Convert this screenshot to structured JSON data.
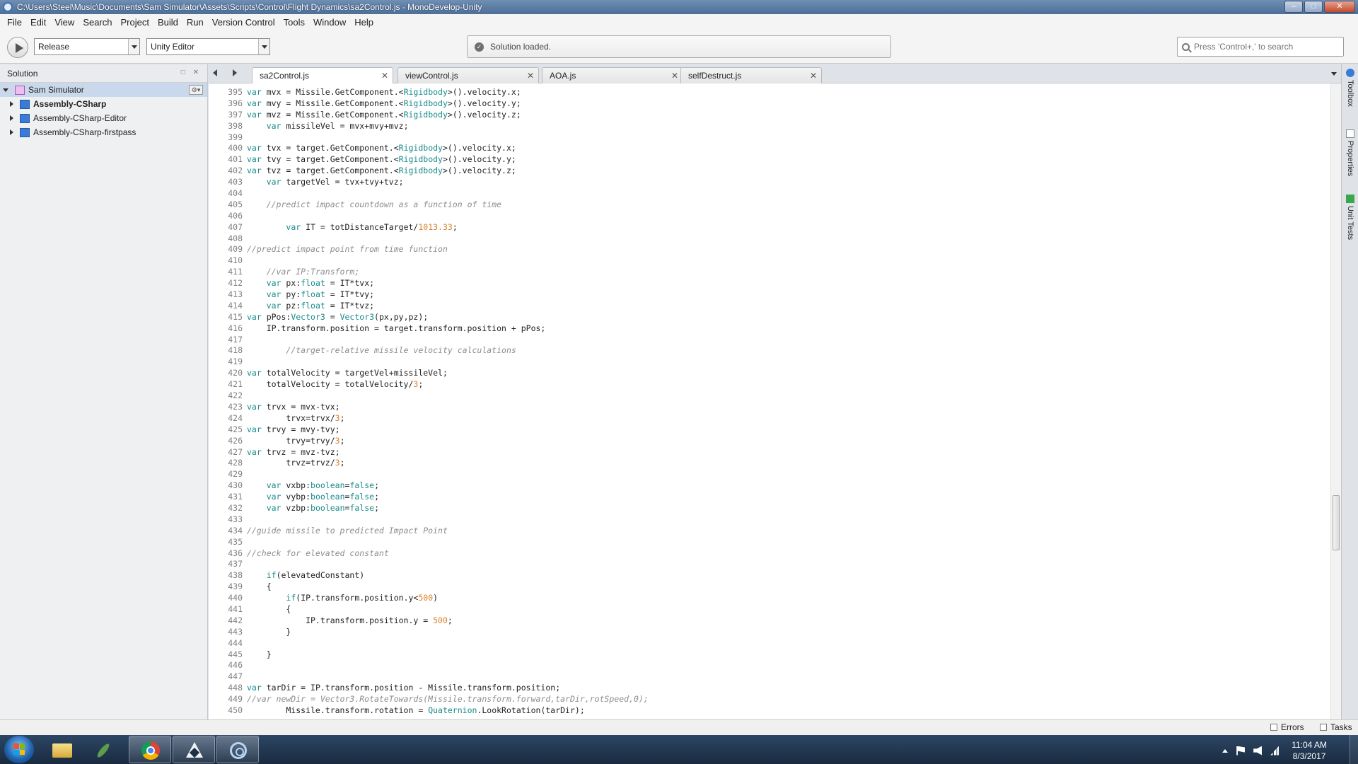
{
  "window": {
    "title": "C:\\Users\\Steel\\Music\\Documents\\Sam Simulator\\Assets\\Scripts\\Control\\Flight Dynamics\\sa2Control.js - MonoDevelop-Unity",
    "controls": {
      "minimize": "–",
      "maximize": "□",
      "close": "✕"
    }
  },
  "menu": [
    "File",
    "Edit",
    "View",
    "Search",
    "Project",
    "Build",
    "Run",
    "Version Control",
    "Tools",
    "Window",
    "Help"
  ],
  "toolbar": {
    "configuration": "Release",
    "runtime": "Unity Editor",
    "status": "Solution loaded.",
    "search_placeholder": "Press 'Control+,' to search"
  },
  "solution": {
    "header": "Solution",
    "header_controls": "□ ✕",
    "root": "Sam Simulator",
    "projects": [
      "Assembly-CSharp",
      "Assembly-CSharp-Editor",
      "Assembly-CSharp-firstpass"
    ]
  },
  "tabs": [
    {
      "label": "sa2Control.js",
      "active": true
    },
    {
      "label": "viewControl.js",
      "active": false
    },
    {
      "label": "AOA.js",
      "active": false
    },
    {
      "label": "selfDestruct.js",
      "active": false
    }
  ],
  "code": [
    {
      "n": "395",
      "t": "var mvx = Missile.GetComponent.<Rigidbody>().velocity.x;"
    },
    {
      "n": "396",
      "t": "var mvy = Missile.GetComponent.<Rigidbody>().velocity.y;"
    },
    {
      "n": "397",
      "t": "var mvz = Missile.GetComponent.<Rigidbody>().velocity.z;"
    },
    {
      "n": "398",
      "t": "    var missileVel = mvx+mvy+mvz;"
    },
    {
      "n": "399",
      "t": ""
    },
    {
      "n": "400",
      "t": "var tvx = target.GetComponent.<Rigidbody>().velocity.x;"
    },
    {
      "n": "401",
      "t": "var tvy = target.GetComponent.<Rigidbody>().velocity.y;"
    },
    {
      "n": "402",
      "t": "var tvz = target.GetComponent.<Rigidbody>().velocity.z;"
    },
    {
      "n": "403",
      "t": "    var targetVel = tvx+tvy+tvz;"
    },
    {
      "n": "404",
      "t": ""
    },
    {
      "n": "405",
      "t": "    //predict impact countdown as a function of time"
    },
    {
      "n": "406",
      "t": ""
    },
    {
      "n": "407",
      "t": "        var IT = totDistanceTarget/1013.33;"
    },
    {
      "n": "408",
      "t": ""
    },
    {
      "n": "409",
      "t": "//predict impact point from time function"
    },
    {
      "n": "410",
      "t": ""
    },
    {
      "n": "411",
      "t": "    //var IP:Transform;"
    },
    {
      "n": "412",
      "t": "    var px:float = IT*tvx;"
    },
    {
      "n": "413",
      "t": "    var py:float = IT*tvy;"
    },
    {
      "n": "414",
      "t": "    var pz:float = IT*tvz;"
    },
    {
      "n": "415",
      "t": "var pPos:Vector3 = Vector3(px,py,pz);"
    },
    {
      "n": "416",
      "t": "    IP.transform.position = target.transform.position + pPos;"
    },
    {
      "n": "417",
      "t": ""
    },
    {
      "n": "418",
      "t": "        //target-relative missile velocity calculations"
    },
    {
      "n": "419",
      "t": ""
    },
    {
      "n": "420",
      "t": "var totalVelocity = targetVel+missileVel;"
    },
    {
      "n": "421",
      "t": "    totalVelocity = totalVelocity/3;"
    },
    {
      "n": "422",
      "t": ""
    },
    {
      "n": "423",
      "t": "var trvx = mvx-tvx;"
    },
    {
      "n": "424",
      "t": "        trvx=trvx/3;"
    },
    {
      "n": "425",
      "t": "var trvy = mvy-tvy;"
    },
    {
      "n": "426",
      "t": "        trvy=trvy/3;"
    },
    {
      "n": "427",
      "t": "var trvz = mvz-tvz;"
    },
    {
      "n": "428",
      "t": "        trvz=trvz/3;"
    },
    {
      "n": "429",
      "t": ""
    },
    {
      "n": "430",
      "t": "    var vxbp:boolean=false;"
    },
    {
      "n": "431",
      "t": "    var vybp:boolean=false;"
    },
    {
      "n": "432",
      "t": "    var vzbp:boolean=false;"
    },
    {
      "n": "433",
      "t": ""
    },
    {
      "n": "434",
      "t": "//guide missile to predicted Impact Point"
    },
    {
      "n": "435",
      "t": ""
    },
    {
      "n": "436",
      "t": "//check for elevated constant"
    },
    {
      "n": "437",
      "t": ""
    },
    {
      "n": "438",
      "t": "    if(elevatedConstant)"
    },
    {
      "n": "439",
      "t": "    {"
    },
    {
      "n": "440",
      "t": "        if(IP.transform.position.y<500)"
    },
    {
      "n": "441",
      "t": "        {"
    },
    {
      "n": "442",
      "t": "            IP.transform.position.y = 500;"
    },
    {
      "n": "443",
      "t": "        }"
    },
    {
      "n": "444",
      "t": ""
    },
    {
      "n": "445",
      "t": "    }"
    },
    {
      "n": "446",
      "t": ""
    },
    {
      "n": "447",
      "t": ""
    },
    {
      "n": "448",
      "t": "var tarDir = IP.transform.position - Missile.transform.position;"
    },
    {
      "n": "449",
      "t": "//var newDir = Vector3.RotateTowards(Missile.transform.forward,tarDir,rotSpeed,0);"
    },
    {
      "n": "450",
      "t": "        Missile.transform.rotation = Quaternion.LookRotation(tarDir);"
    }
  ],
  "dock": [
    "Toolbox",
    "Properties",
    "Unit Tests"
  ],
  "statusbar": {
    "errors": "Errors",
    "tasks": "Tasks"
  },
  "taskbar": {
    "apps": [
      "windows-explorer",
      "feather-app",
      "chrome",
      "unity",
      "monodevelop"
    ],
    "clock_time": "11:04 AM",
    "clock_date": "8/3/2017"
  },
  "colors": {
    "keyword": "#1a8a8a",
    "number": "#d9822b",
    "comment": "#8d8d8d",
    "selection": "#c9d8ea"
  }
}
